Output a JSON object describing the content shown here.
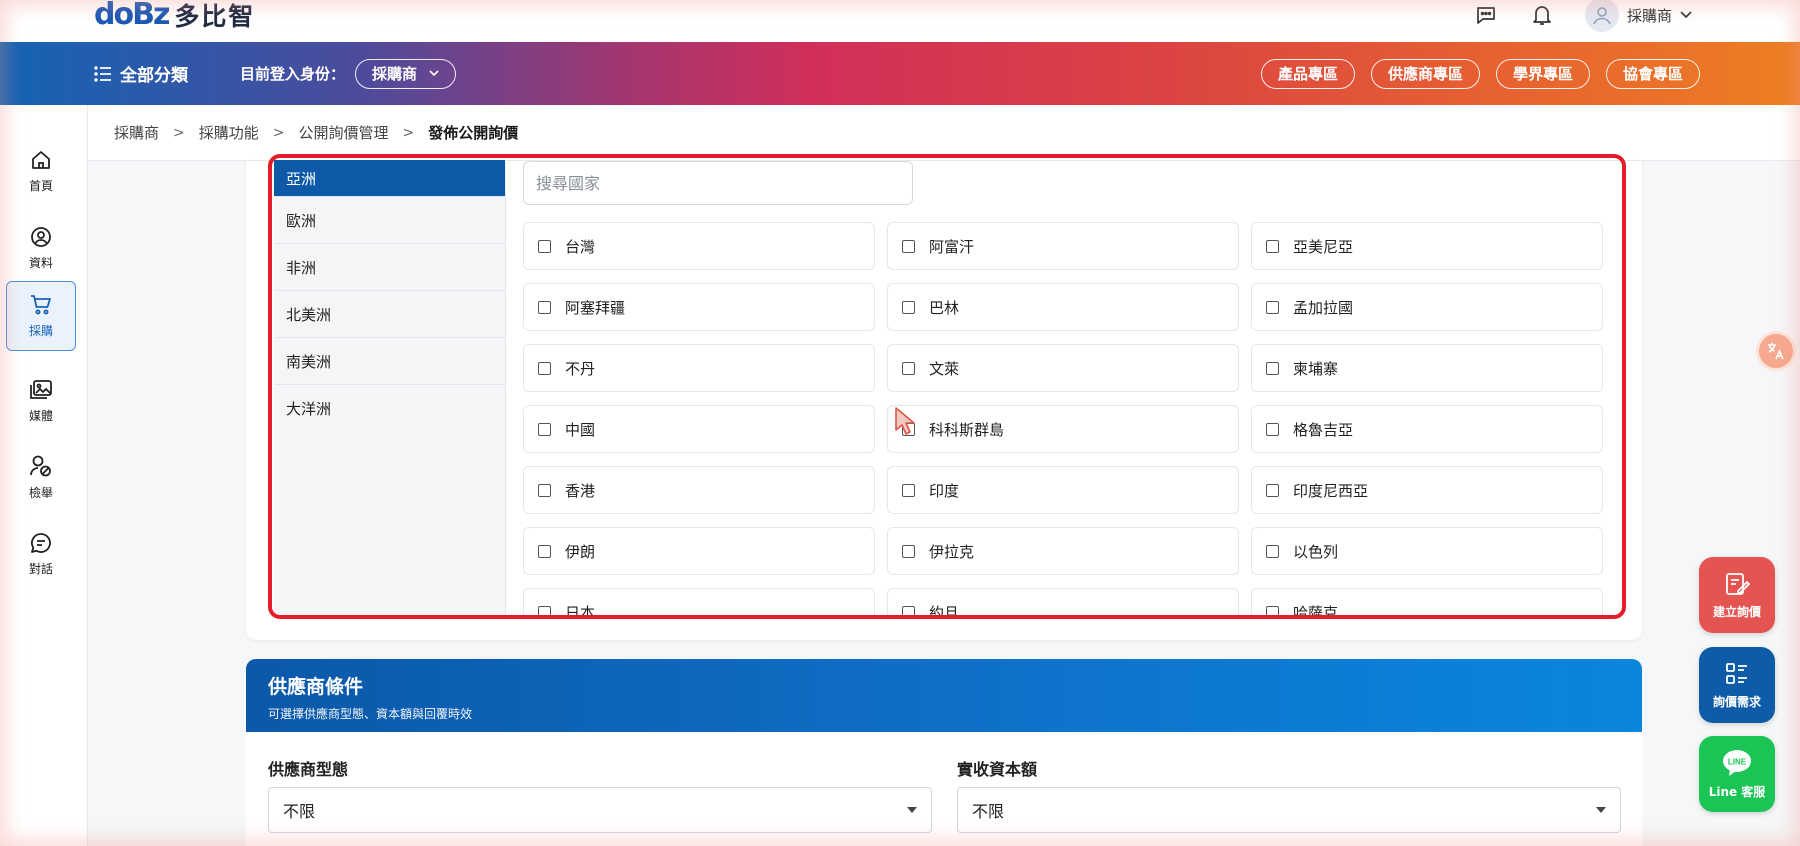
{
  "header": {
    "logo_mark": "doBz",
    "logo_text": "多比智",
    "user_name": "採購商"
  },
  "nav": {
    "all_categories": "全部分類",
    "role_label": "目前登入身份：",
    "role_value": "採購商",
    "links": [
      "產品專區",
      "供應商專區",
      "學界專區",
      "協會專區"
    ]
  },
  "rail": {
    "items": [
      {
        "label": "首頁",
        "icon": "home-icon"
      },
      {
        "label": "資料",
        "icon": "user-circle-icon"
      },
      {
        "label": "採購",
        "icon": "cart-icon"
      },
      {
        "label": "媒體",
        "icon": "media-icon"
      },
      {
        "label": "檢舉",
        "icon": "report-icon"
      },
      {
        "label": "對話",
        "icon": "chat-icon"
      }
    ]
  },
  "breadcrumb": [
    "採購商",
    "採購功能",
    "公開詢價管理",
    "發佈公開詢價"
  ],
  "regions": [
    "亞洲",
    "歐洲",
    "非洲",
    "北美洲",
    "南美洲",
    "大洋洲"
  ],
  "search": {
    "placeholder": "搜尋國家",
    "value": ""
  },
  "countries": [
    "台灣",
    "阿富汗",
    "亞美尼亞",
    "阿塞拜疆",
    "巴林",
    "孟加拉國",
    "不丹",
    "文萊",
    "柬埔寨",
    "中國",
    "科科斯群島",
    "格魯吉亞",
    "香港",
    "印度",
    "印度尼西亞",
    "伊朗",
    "伊拉克",
    "以色列",
    "日本",
    "約旦",
    "哈薩克"
  ],
  "supplier": {
    "title": "供應商條件",
    "subtitle": "可選擇供應商型態、資本額與回覆時效",
    "type_label": "供應商型態",
    "type_value": "不限",
    "capital_label": "實收資本額",
    "capital_value": "不限"
  },
  "fabs": {
    "create": "建立詢價",
    "needs": "詢價需求",
    "line": "Line 客服",
    "line_logo": "LINE"
  },
  "colors": {
    "accent": "#0f5aa8",
    "highlight": "#e41d2b",
    "fab_red": "#e45450",
    "fab_green": "#1ac455"
  }
}
